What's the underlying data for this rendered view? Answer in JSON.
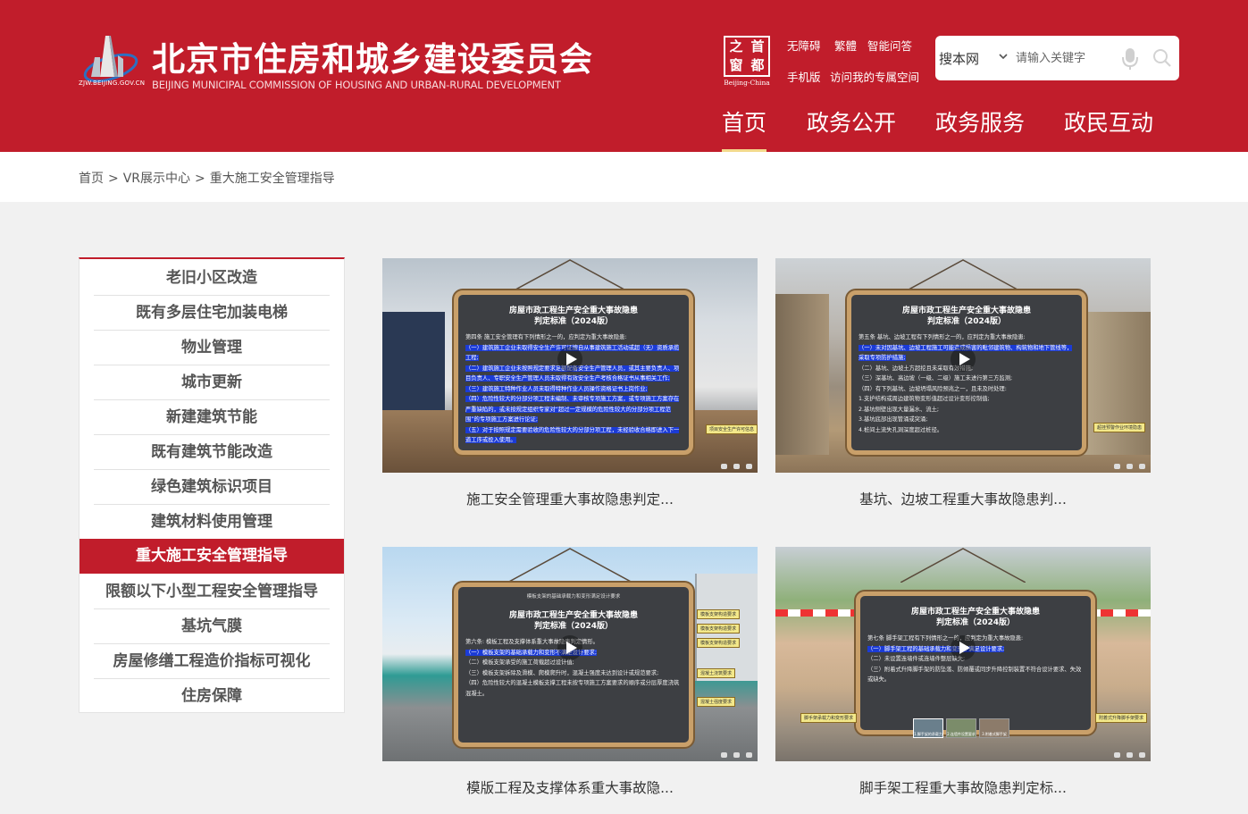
{
  "header": {
    "logo_url_text": "ZJW.BEIJING.GOV.CN",
    "title": "北京市住房和城乡建设委员会",
    "subtitle": "BEIJING MUNICIPAL COMMISSION OF HOUSING AND URBAN-RURAL DEVELOPMENT",
    "capital_logo": {
      "chars": [
        "首",
        "都",
        "之",
        "窗"
      ],
      "caption": "Beijing-China"
    },
    "links": [
      "无障碍",
      "繁體",
      "智能问答",
      "手机版",
      "访问我的专属空间"
    ],
    "search": {
      "scope": "搜本网",
      "placeholder": "请输入关键字"
    },
    "nav": [
      "首页",
      "政务公开",
      "政务服务",
      "政民互动"
    ],
    "nav_active": "首页"
  },
  "breadcrumb": [
    "首页",
    "VR展示中心",
    "重大施工安全管理指导"
  ],
  "sidebar": {
    "items": [
      "老旧小区改造",
      "既有多层住宅加装电梯",
      "物业管理",
      "城市更新",
      "新建建筑节能",
      "既有建筑节能改造",
      "绿色建筑标识项目",
      "建筑材料使用管理",
      "重大施工安全管理指导",
      "限额以下小型工程安全管理指导",
      "基坑气膜",
      "房屋修缮工程造价指标可视化",
      "住房保障"
    ],
    "active": "重大施工安全管理指导"
  },
  "cards": [
    {
      "title": "施工安全管理重大事故隐患判定...",
      "board_title": "房屋市政工程生产安全重大事故隐患\n判定标准（2024版）",
      "board_lead": "第四条 施工安全管理有下列情形之一的，应判定为重大事故隐患:",
      "board_lines": [
        "（一）建筑施工企业未取得安全生产许可证擅自从事建筑施工活动或超（无）资质承揽工程;",
        "（二）建筑施工企业未按照规定要求足额配备安全生产管理人员，或其主要负责人、项目负责人、专职安全生产管理人员未取得有效安全生产考核合格证书从事相关工作;",
        "（三）建筑施工特种作业人员未取得特种作业人员操作资格证书上岗作业;",
        "（四）危险性较大的分部分项工程未编制、未审核专项施工方案，或专项施工方案存在严重缺陷的，或未按规定组织专家对“超过一定规模的危险性较大的分部分项工程范围”的专项施工方案进行论证;",
        "（五）对于按照规定需要验收的危险性较大的分部分项工程，未经验收合格即进入下一道工序或投入使用。"
      ],
      "hotspot": "项目安全生产许可信息"
    },
    {
      "title": "基坑、边坡工程重大事故隐患判...",
      "board_title": "房屋市政工程生产安全重大事故隐患\n判定标准（2024版）",
      "board_lead": "第五条 基坑、边坡工程有下列情形之一的，应判定为重大事故隐患:",
      "board_lines": [
        "（一）未对因基坑、边坡工程施工可能造成损害的毗邻建筑物、构筑物和地下管线等，采取专项防护措施;",
        "（二）基坑、边坡土方超挖且未采取有效措施;",
        "（三）深基坑、高边坡（一级、二级）施工未进行第三方监测;",
        "（四）有下列基坑、边坡坍塌风险预兆之一，且未及时处理:",
        "1.支护结构或周边建筑物变形值超过设计变形控制值;",
        "2.基坑侧壁出现大量漏水、流土;",
        "3.基坑底部出现管涌或突涌;",
        "4.桩间土流失孔洞深度超过桩径。"
      ],
      "hotspot": "超挂预警作业环境隐患"
    },
    {
      "title": "模版工程及支撑体系重大事故隐...",
      "board_top": "模板支架的基础承载力和变形满足设计要求",
      "board_title": "房屋市政工程生产安全重大事故隐患\n判定标准（2024版）",
      "board_lead": "第六条: 模板工程及支撑体系重大事故隐患判定情形。",
      "board_lines": [
        "（一）模板支架的基础承载力和变形不满足设计要求;",
        "（二）模板支架承受的施工荷载超过设计值;",
        "（三）模板支架拆除及滑模、爬模爬升时，混凝土强度未达到设计或规范要求;",
        "（四）危险性较大的混凝土模板支撑工程未按专项施工方案要求的顺序或分层厚度浇筑混凝土。"
      ],
      "hotspots": [
        "模板支架构造要求",
        "模板支架构造要求",
        "模板支架构造要求",
        "混凝土浇筑要求",
        "混凝土强度要求"
      ]
    },
    {
      "title": "脚手架工程重大事故隐患判定标...",
      "board_title": "房屋市政工程生产安全重大事故隐患\n判定标准（2024版）",
      "board_lead": "第七条 脚手架工程有下列情形之一的，应判定为重大事故隐患:",
      "board_lines": [
        "（一）脚手架工程的基础承载力和变形不满足设计要求;",
        "（二）未设置连墙件或连墙件整层缺失;",
        "（三）附着式升降脚手架的防坠落、防倾覆或同步升降控制装置不符合设计要求、失效或缺失。"
      ],
      "hotspots": [
        "脚手架承载力和变形要求",
        "附着式升降脚手架要求"
      ],
      "thumbnails": [
        "1.脚手架的承载力",
        "2.连墙件设置要求",
        "3.附着式脚手架"
      ]
    }
  ]
}
